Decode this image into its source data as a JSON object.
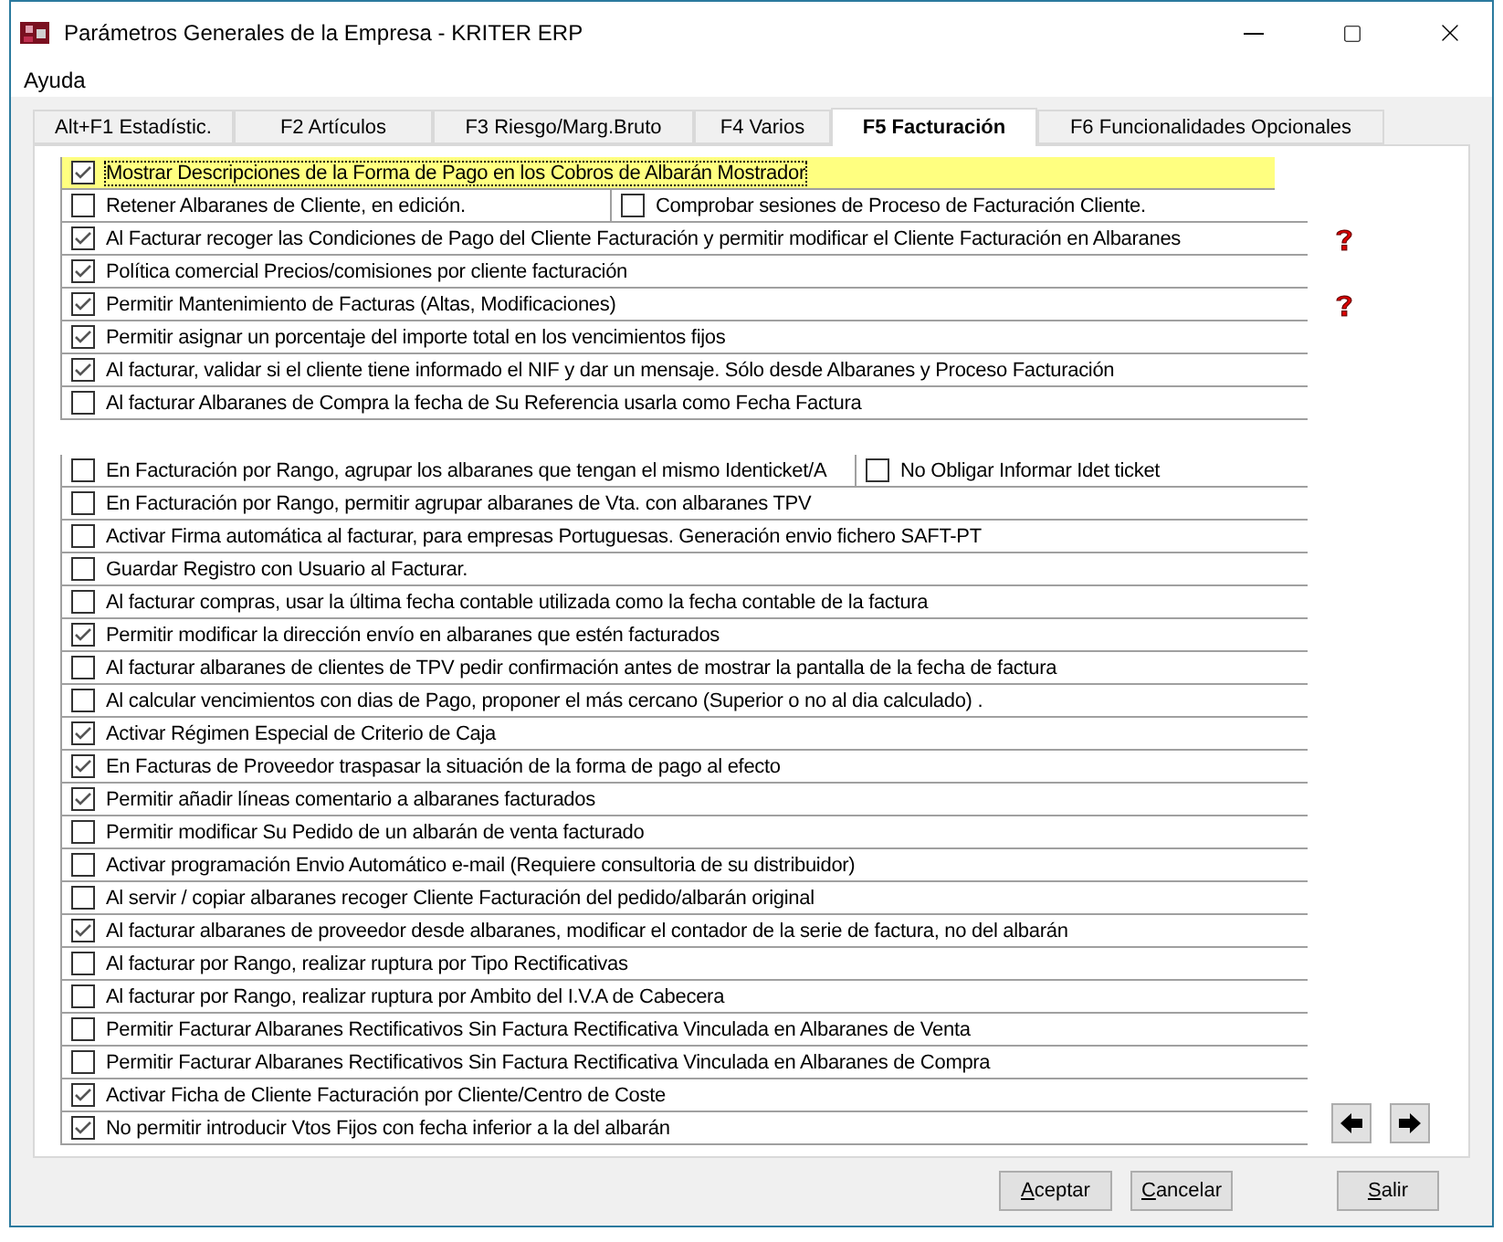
{
  "window": {
    "title": "Parámetros Generales de la Empresa - KRITER ERP"
  },
  "menu": [
    "Ayuda"
  ],
  "tabs": [
    {
      "label": "Alt+F1 Estadístic.",
      "selected": false
    },
    {
      "label": "F2 Artículos",
      "selected": false
    },
    {
      "label": "F3 Riesgo/Marg.Bruto",
      "selected": false
    },
    {
      "label": "F4 Varios",
      "selected": false
    },
    {
      "label": "F5 Facturación",
      "selected": true
    },
    {
      "label": "F6 Funcionalidades Opcionales",
      "selected": false
    }
  ],
  "groups": [
    {
      "rows": [
        {
          "label": "Mostrar Descripciones de la Forma de Pago en los Cobros de Albarán Mostrador",
          "checked": true,
          "highlighted": true,
          "help": false
        },
        {
          "label": "Retener Albaranes de Cliente, en edición.",
          "checked": false,
          "highlighted": false,
          "help": false,
          "extra": {
            "label": "Comprobar sesiones de Proceso de Facturación Cliente.",
            "checked": false
          }
        },
        {
          "label": "Al Facturar recoger las Condiciones de Pago del Cliente Facturación y permitir modificar el Cliente Facturación en Albaranes",
          "checked": true,
          "highlighted": false,
          "help": true
        },
        {
          "label": "Política comercial Precios/comisiones por cliente facturación",
          "checked": true,
          "highlighted": false,
          "help": false
        },
        {
          "label": "Permitir Mantenimiento de Facturas (Altas, Modificaciones)",
          "checked": true,
          "highlighted": false,
          "help": true
        },
        {
          "label": "Permitir asignar un porcentaje del importe total en los vencimientos fijos",
          "checked": true,
          "highlighted": false,
          "help": false
        },
        {
          "label": "Al facturar, validar si el cliente tiene informado el NIF y dar un mensaje. Sólo desde Albaranes y Proceso Facturación",
          "checked": true,
          "highlighted": false,
          "help": false
        },
        {
          "label": "Al facturar Albaranes de Compra la fecha de Su Referencia usarla como Fecha Factura",
          "checked": false,
          "highlighted": false,
          "help": false
        }
      ]
    },
    {
      "rows": [
        {
          "label": "En Facturación por Rango, agrupar los albaranes que tengan el mismo Identicket/A",
          "checked": false,
          "highlighted": false,
          "help": false,
          "extra": {
            "label": "No Obligar Informar Idet ticket",
            "checked": false
          }
        },
        {
          "label": "En Facturación por Rango, permitir agrupar albaranes de Vta. con albaranes TPV",
          "checked": false,
          "highlighted": false,
          "help": false
        },
        {
          "label": "Activar Firma automática al facturar, para empresas Portuguesas. Generación envio fichero SAFT-PT",
          "checked": false,
          "highlighted": false,
          "help": false
        },
        {
          "label": "Guardar Registro con Usuario al Facturar.",
          "checked": false,
          "highlighted": false,
          "help": false
        },
        {
          "label": "Al facturar compras, usar la última fecha contable utilizada como la fecha contable de la factura",
          "checked": false,
          "highlighted": false,
          "help": false
        },
        {
          "label": "Permitir modificar la dirección envío en albaranes que estén facturados",
          "checked": true,
          "highlighted": false,
          "help": false
        },
        {
          "label": "Al facturar albaranes de clientes de TPV pedir confirmación antes de mostrar la pantalla de la fecha de factura",
          "checked": false,
          "highlighted": false,
          "help": false
        },
        {
          "label": "Al calcular vencimientos con dias de Pago, proponer el más cercano (Superior o no al dia calculado) .",
          "checked": false,
          "highlighted": false,
          "help": false
        },
        {
          "label": "Activar Régimen Especial de Criterio de Caja",
          "checked": true,
          "highlighted": false,
          "help": false
        },
        {
          "label": "En Facturas de Proveedor traspasar la situación de la forma de pago al efecto",
          "checked": true,
          "highlighted": false,
          "help": false
        },
        {
          "label": "Permitir añadir líneas comentario a albaranes facturados",
          "checked": true,
          "highlighted": false,
          "help": false
        },
        {
          "label": "Permitir modificar Su Pedido de un albarán de venta facturado",
          "checked": false,
          "highlighted": false,
          "help": false
        },
        {
          "label": "Activar programación Envio Automático e-mail (Requiere consultoria de su distribuidor)",
          "checked": false,
          "highlighted": false,
          "help": false
        },
        {
          "label": "Al servir / copiar albaranes recoger Cliente Facturación del pedido/albarán original",
          "checked": false,
          "highlighted": false,
          "help": false
        },
        {
          "label": "Al facturar albaranes de proveedor desde albaranes, modificar el contador de la serie de factura, no del albarán",
          "checked": true,
          "highlighted": false,
          "help": false
        },
        {
          "label": "Al facturar por Rango, realizar ruptura por Tipo Rectificativas",
          "checked": false,
          "highlighted": false,
          "help": false
        },
        {
          "label": "Al facturar por Rango, realizar ruptura por Ambito del I.V.A de Cabecera",
          "checked": false,
          "highlighted": false,
          "help": false
        },
        {
          "label": "Permitir Facturar Albaranes Rectificativos Sin Factura Rectificativa Vinculada en Albaranes de Venta",
          "checked": false,
          "highlighted": false,
          "help": false
        },
        {
          "label": "Permitir Facturar Albaranes Rectificativos Sin Factura Rectificativa Vinculada en Albaranes de Compra",
          "checked": false,
          "highlighted": false,
          "help": false
        },
        {
          "label": "Activar Ficha de Cliente Facturación por Cliente/Centro de Coste",
          "checked": true,
          "highlighted": false,
          "help": false
        },
        {
          "label": "No permitir introducir Vtos Fijos con fecha inferior a la del albarán",
          "checked": true,
          "highlighted": false,
          "help": false
        }
      ]
    }
  ],
  "buttons": [
    "Aceptar",
    "Cancelar",
    "Salir"
  ]
}
